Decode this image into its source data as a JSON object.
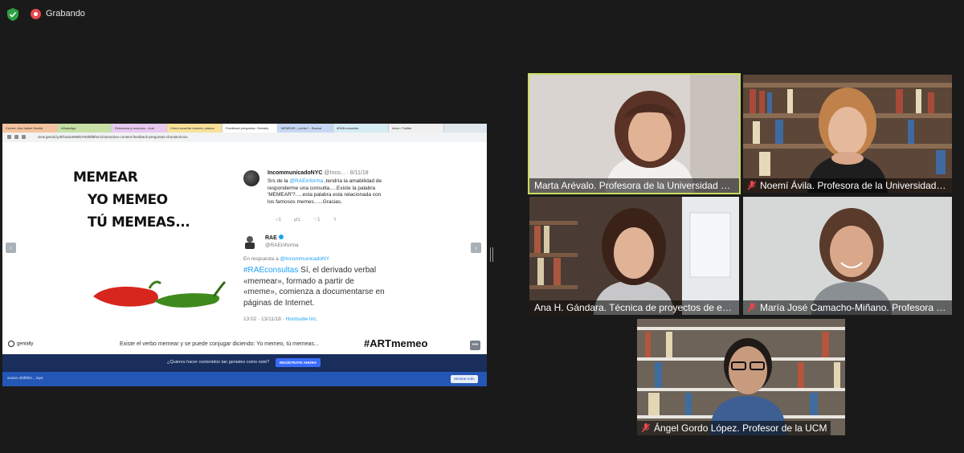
{
  "status_bar": {
    "recording_label": "Grabando",
    "recording_color": "#e5484d",
    "security_icon": "shield-check-icon"
  },
  "shared_screen": {
    "browser": {
      "tabs": [
        "Correo: Ana Isabel Bonilla",
        "WhatsApp",
        "Estructura y recursos - eval",
        "Cómo enseñar memes: planea",
        "Feedback preguntas: Genially",
        "MEMEAR: ¿verbo? - Buscar",
        "#RAEconsultas",
        "Inicio / Twitter"
      ],
      "url": "view.genial.ly/5f16a34998b700d8f8f041/interactive-content-feedback-preguntas-cbontarvimox"
    },
    "slide": {
      "title_lines": [
        "MEMEAR",
        "YO MEMEO",
        "TÚ MEMEAS..."
      ],
      "tweet_user": {
        "name": "IncommunicadoNYC",
        "handle": "@Inco...",
        "date": "· 8/11/18",
        "text_prefix": "Srs de la ",
        "mention": "@RAEinforma",
        "text_suffix": " ,tendría la amabilidad de responderme una consulta.....Existe la palabra 'MEMEAR'?.....esta palabra esta relacionada con los famosos memes......Gracias.",
        "replies": "1",
        "retweets": "1",
        "likes": "1"
      },
      "tweet_rae": {
        "name": "RAE",
        "handle": "@RAEinforma",
        "reply_label": "En respuesta a ",
        "reply_mention": "@IncommunicadoNY",
        "hashtag": "#RAEconsultas",
        "text": " Sí, el derivado verbal «memear», formado a partir de «meme», comienza a documentarse en páginas de Internet.",
        "time": "13:02 · 13/11/18 · ",
        "source": "Hootsuite Inc."
      },
      "brand": "genially",
      "caption": "Existe el verbo memear y se puede conjugar diciendo: Yo memeo, tú memeas...",
      "hashtag": "#ARTmemeo",
      "prev_icon": "chevron-left-icon",
      "next_icon": "chevron-right-icon",
      "more_icon": "ellipsis-icon"
    },
    "cta": {
      "text": "¿Quieres hacer contenidos tan geniales como este?",
      "button": "REGÍSTRATE AHORA"
    },
    "downloads": {
      "item": "sesion-4f4f9f24....mp4",
      "show_all": "Mostrar todo"
    }
  },
  "participants": [
    {
      "name": "Marta Arévalo. Profesora de la Universidad de...",
      "muted": false,
      "active_speaker": true
    },
    {
      "name": "Noemí Ávila. Profesora de la Universidad C...",
      "muted": true,
      "active_speaker": false
    },
    {
      "name": "Ana H. Gándara. Técnica de proyectos de edu...",
      "muted": false,
      "active_speaker": false
    },
    {
      "name": "María José Camacho-Miñano. Profesora de...",
      "muted": true,
      "active_speaker": false
    },
    {
      "name": "Ángel Gordo López. Profesor de la UCM",
      "muted": true,
      "active_speaker": false
    }
  ],
  "colors": {
    "background": "#1a1a1a",
    "active_border": "#c9dc5a",
    "muted_icon": "#e5484d",
    "link_blue": "#1da1f2",
    "cta_background": "#192e5b"
  }
}
